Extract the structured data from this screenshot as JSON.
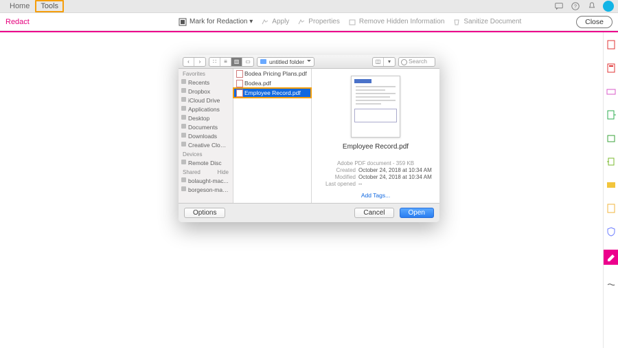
{
  "top": {
    "home": "Home",
    "tools": "Tools"
  },
  "toolbar": {
    "title": "Redact",
    "mark": "Mark for Redaction ▾",
    "apply": "Apply",
    "properties": "Properties",
    "remove": "Remove Hidden Information",
    "sanitize": "Sanitize Document",
    "close": "Close"
  },
  "dialog": {
    "folder": "untitled folder",
    "search_ph": "Search",
    "sidebar": {
      "favorites": "Favorites",
      "items_fav": [
        "Recents",
        "Dropbox",
        "iCloud Drive",
        "Applications",
        "Desktop",
        "Documents",
        "Downloads",
        "Creative Cloud..."
      ],
      "devices": "Devices",
      "items_dev": [
        "Remote Disc"
      ],
      "shared": "Shared",
      "hide": "Hide",
      "items_sh": [
        "bolaught-mac...",
        "borgeson-mac..."
      ]
    },
    "files": [
      "Bodea Pricing Plans.pdf",
      "Bodea.pdf",
      "Employee Record.pdf"
    ],
    "selected_index": 2,
    "preview": {
      "name": "Employee Record.pdf",
      "kind": "Adobe PDF document - 359 KB",
      "created_l": "Created",
      "created_v": "October 24, 2018 at 10:34 AM",
      "modified_l": "Modified",
      "modified_v": "October 24, 2018 at 10:34 AM",
      "opened_l": "Last opened",
      "opened_v": "--",
      "addtags": "Add Tags..."
    },
    "options": "Options",
    "cancel": "Cancel",
    "open": "Open"
  }
}
